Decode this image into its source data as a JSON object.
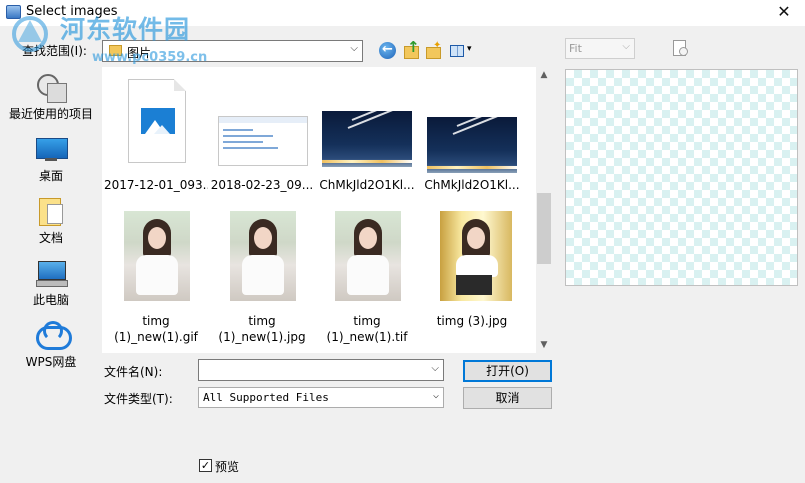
{
  "window": {
    "title": "Select images",
    "close_glyph": "✕"
  },
  "watermark": {
    "text": "河东软件园",
    "url": "www.pc0359.cn"
  },
  "look_in": {
    "label": "查找范围(I):",
    "value": "图片"
  },
  "toolbar": {
    "view_dropdown_glyph": "▾"
  },
  "places": [
    {
      "label": "最近使用的项目",
      "icon": "recent-places-icon"
    },
    {
      "label": "桌面",
      "icon": "desktop-icon"
    },
    {
      "label": "文档",
      "icon": "documents-icon"
    },
    {
      "label": "此电脑",
      "icon": "this-pc-icon"
    },
    {
      "label": "WPS网盘",
      "icon": "wps-cloud-icon"
    }
  ],
  "files": [
    {
      "name": "2017-12-01_093...",
      "thumb": "image-placeholder"
    },
    {
      "name": "2018-02-23_09...",
      "thumb": "screenshot"
    },
    {
      "name": "ChMkJld2O1Kl...",
      "thumb": "night-sky"
    },
    {
      "name": "ChMkJld2O1Kl...",
      "thumb": "night-sky"
    },
    {
      "name_line1": "timg",
      "name_line2": "(1)_new(1).gif",
      "thumb": "portrait"
    },
    {
      "name_line1": "timg",
      "name_line2": "(1)_new(1).jpg",
      "thumb": "portrait"
    },
    {
      "name_line1": "timg",
      "name_line2": "(1)_new(1).tif",
      "thumb": "portrait"
    },
    {
      "name": "timg (3).jpg",
      "thumb": "portrait-warm"
    }
  ],
  "scroll": {
    "up": "▲",
    "down": "▼"
  },
  "file_name": {
    "label": "文件名(N):",
    "value": ""
  },
  "file_type": {
    "label": "文件类型(T):",
    "value": "All Supported Files"
  },
  "buttons": {
    "open": "打开(O)",
    "cancel": "取消"
  },
  "preview": {
    "fit_value": "Fit",
    "checkbox_label": "预览",
    "checkbox_checked": true,
    "check_glyph": "✓"
  },
  "colors": {
    "accent": "#0078d7",
    "watermark": "#2896dc",
    "checker": "#d9f1f1"
  }
}
